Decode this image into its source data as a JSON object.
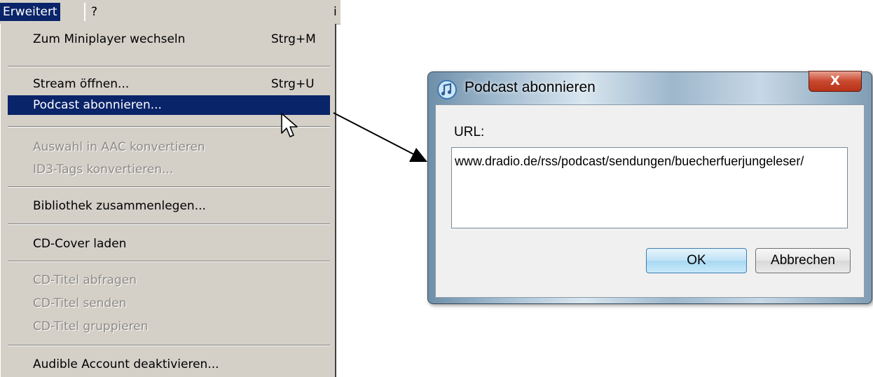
{
  "menubar": {
    "active_menu": "Erweitert",
    "help_menu": "?",
    "stub": "i"
  },
  "menu": {
    "items": [
      {
        "label": "Zum Miniplayer wechseln",
        "shortcut": "Strg+M"
      },
      {
        "label": "Stream öffnen...",
        "shortcut": "Strg+U"
      },
      {
        "label": "Podcast abonnieren...",
        "shortcut": ""
      },
      {
        "label": "Auswahl in AAC konvertieren",
        "shortcut": ""
      },
      {
        "label": "ID3-Tags konvertieren...",
        "shortcut": ""
      },
      {
        "label": "Bibliothek zusammenlegen...",
        "shortcut": ""
      },
      {
        "label": "CD-Cover laden",
        "shortcut": ""
      },
      {
        "label": "CD-Titel abfragen",
        "shortcut": ""
      },
      {
        "label": "CD-Titel senden",
        "shortcut": ""
      },
      {
        "label": "CD-Titel gruppieren",
        "shortcut": ""
      },
      {
        "label": "Audible Account deaktivieren...",
        "shortcut": ""
      }
    ]
  },
  "dialog": {
    "title": "Podcast abonnieren",
    "close_glyph": "X",
    "url_label": "URL:",
    "url_value": "www.dradio.de/rss/podcast/sendungen/buecherfuerjungeleser/",
    "ok_label": "OK",
    "cancel_label": "Abbrechen"
  },
  "colors": {
    "menu_bg": "#d4d0c8",
    "highlight": "#0a246a",
    "disabled_text": "#8d8a85"
  }
}
